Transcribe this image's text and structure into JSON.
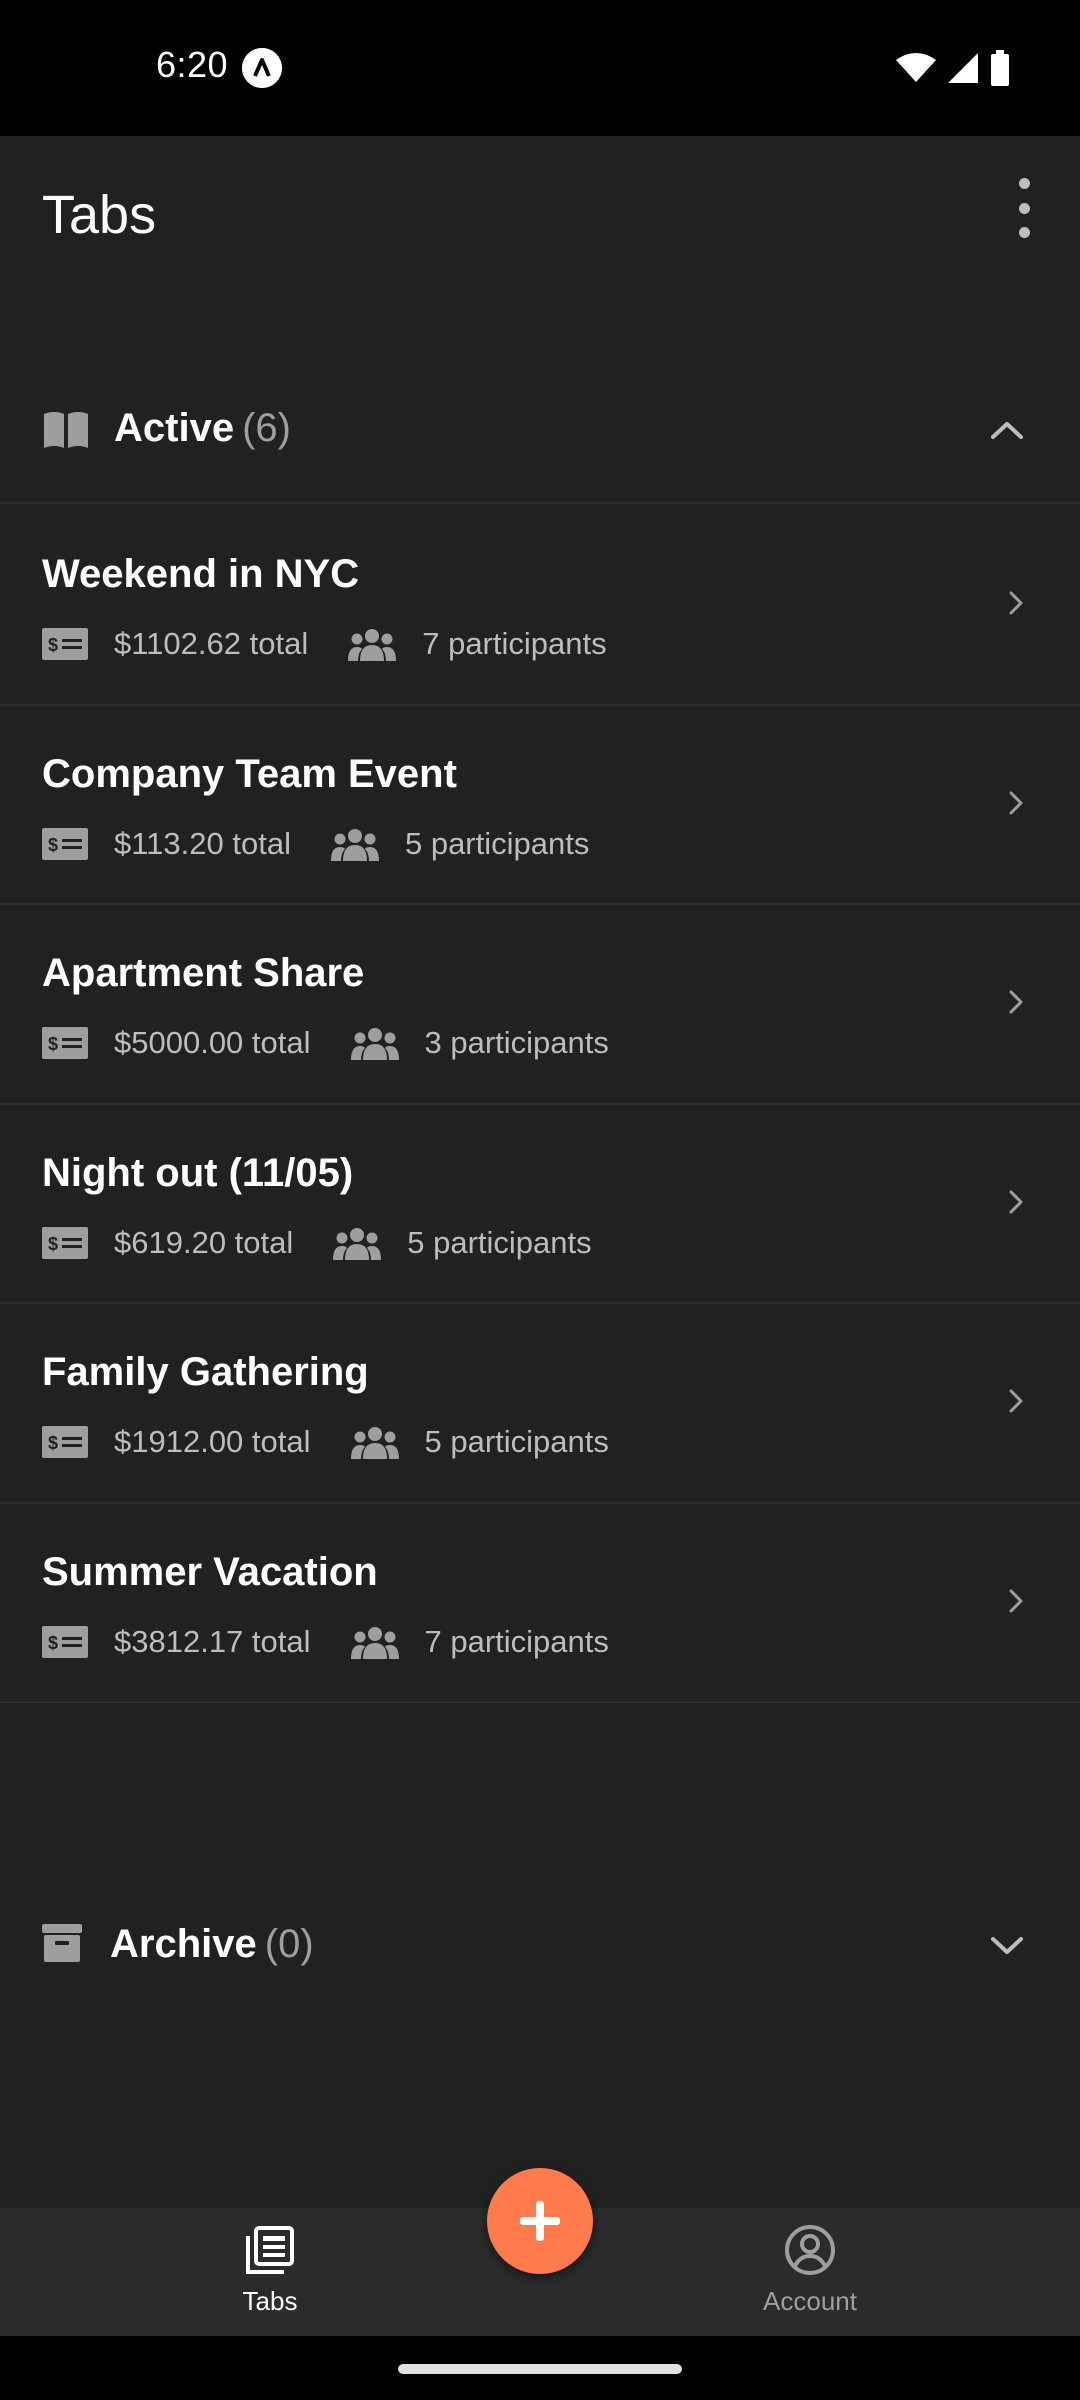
{
  "status_bar": {
    "time": "6:20",
    "app_icon": "a-logo-icon",
    "icons": [
      "wifi-icon",
      "signal-icon",
      "battery-icon"
    ]
  },
  "header": {
    "title": "Tabs",
    "menu_icon": "more-vert-icon"
  },
  "sections": {
    "active": {
      "label": "Active",
      "count": "(6)",
      "icon": "book-icon",
      "expanded": true
    },
    "archive": {
      "label": "Archive",
      "count": "(0)",
      "icon": "archive-icon",
      "expanded": false
    }
  },
  "tabs": [
    {
      "name": "Weekend in NYC",
      "total": "$1102.62 total",
      "participants": "7 participants"
    },
    {
      "name": "Company Team Event",
      "total": "$113.20 total",
      "participants": "5 participants"
    },
    {
      "name": "Apartment Share",
      "total": "$5000.00 total",
      "participants": "3 participants"
    },
    {
      "name": "Night out (11/05)",
      "total": "$619.20 total",
      "participants": "5 participants"
    },
    {
      "name": "Family Gathering",
      "total": "$1912.00 total",
      "participants": "5 participants"
    },
    {
      "name": "Summer Vacation",
      "total": "$3812.17 total",
      "participants": "7 participants"
    }
  ],
  "bottom_nav": {
    "items": [
      {
        "label": "Tabs",
        "icon": "tabs-icon",
        "active": true
      },
      {
        "label": "Account",
        "icon": "account-circle-icon",
        "active": false
      }
    ],
    "fab_icon": "plus-icon"
  },
  "colors": {
    "background": "#212121",
    "accent": "#ff7a4d",
    "secondary_text": "#bdbdbd",
    "muted_text": "#9e9e9e"
  }
}
